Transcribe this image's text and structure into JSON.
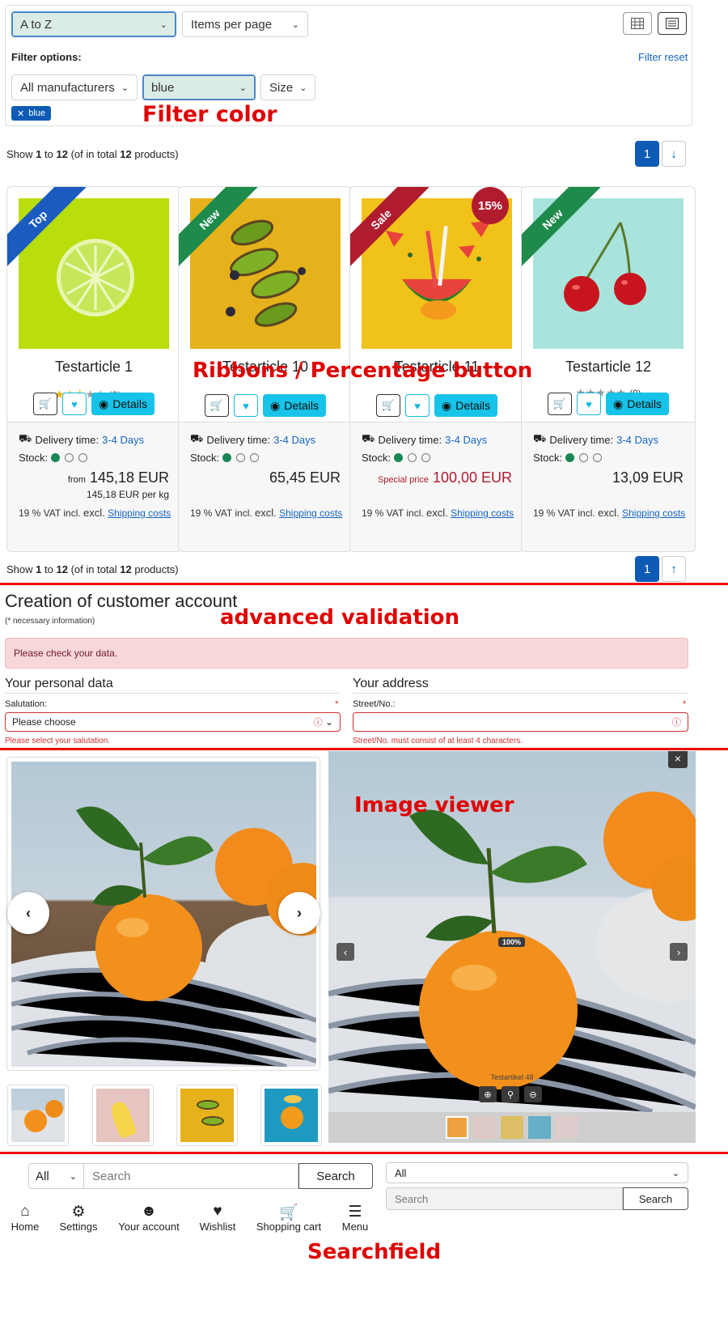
{
  "filters": {
    "sort_value": "A to Z",
    "items_per_page": "Items per page",
    "filter_options_label": "Filter options:",
    "filter_reset": "Filter reset",
    "manufacturer": "All manufacturers",
    "color": "blue",
    "size": "Size",
    "active_tag": "blue"
  },
  "listing": {
    "summary_prefix": "Show",
    "from": "1",
    "to_word": "to",
    "to": "12",
    "of_word": "(of in total",
    "total": "12",
    "products_word": "products)",
    "page": "1"
  },
  "products": [
    {
      "title": "Testarticle 1",
      "ribbon": "Top",
      "ribbon_color": "#1a5bbf",
      "rating_count": "(2)",
      "delivery_label": "Delivery time:",
      "delivery": "3-4 Days",
      "stock_label": "Stock:",
      "price_prefix": "from",
      "price": "145,18 EUR",
      "base_price": "145,18 EUR per kg",
      "vat": "19 % VAT incl.",
      "excl": "excl.",
      "shipping": "Shipping costs",
      "details": "Details"
    },
    {
      "title": "Testarticle 10",
      "ribbon": "New",
      "ribbon_color": "#1e8a4c",
      "delivery_label": "Delivery time:",
      "delivery": "3-4 Days",
      "stock_label": "Stock:",
      "price": "65,45 EUR",
      "vat": "19 % VAT incl.",
      "excl": "excl.",
      "shipping": "Shipping costs",
      "details": "Details"
    },
    {
      "title": "Testarticle 11",
      "ribbon": "Sale",
      "ribbon_color": "#b01c2e",
      "badge": "15%",
      "delivery_label": "Delivery time:",
      "delivery": "3-4 Days",
      "stock_label": "Stock:",
      "price_prefix": "Special price",
      "price": "100,00 EUR",
      "vat": "19 % VAT incl.",
      "excl": "excl.",
      "shipping": "Shipping costs",
      "details": "Details"
    },
    {
      "title": "Testarticle 12",
      "ribbon": "New",
      "ribbon_color": "#1e8a4c",
      "rating_count": "(0)",
      "delivery_label": "Delivery time:",
      "delivery": "3-4 Days",
      "stock_label": "Stock:",
      "price": "13,09 EUR",
      "vat": "19 % VAT incl.",
      "excl": "excl.",
      "shipping": "Shipping costs",
      "details": "Details"
    }
  ],
  "account": {
    "title": "Creation of customer account",
    "required_note": "(* necessary information)",
    "alert": "Please check your data.",
    "personal_heading": "Your personal data",
    "salutation_label": "Salutation:",
    "salutation_value": "Please choose",
    "salutation_error": "Please select your salutation.",
    "address_heading": "Your address",
    "street_label": "Street/No.:",
    "street_error": "Street/No. must consist of at least 4 characters.",
    "required_mark": "*"
  },
  "viewer": {
    "zoom": "100%",
    "caption": "Testartikel 48",
    "close": "×"
  },
  "search": {
    "category": "All",
    "placeholder": "Search",
    "button": "Search",
    "category2": "All",
    "placeholder2": "Search",
    "button2": "Search"
  },
  "bottom_nav": [
    "Home",
    "Settings",
    "Your account",
    "Wishlist",
    "Shopping cart",
    "Menu"
  ],
  "annotations": {
    "filter_color": "Filter color",
    "ribbons": "Ribbons / Percentage button",
    "validation": "advanced validation",
    "image_viewer": "Image viewer",
    "searchfield": "Searchfield"
  },
  "colors": {
    "primary": "#0d5bb5",
    "details_button": "#17c3e8",
    "error": "#d32f2f",
    "annotation": "#e00000"
  }
}
